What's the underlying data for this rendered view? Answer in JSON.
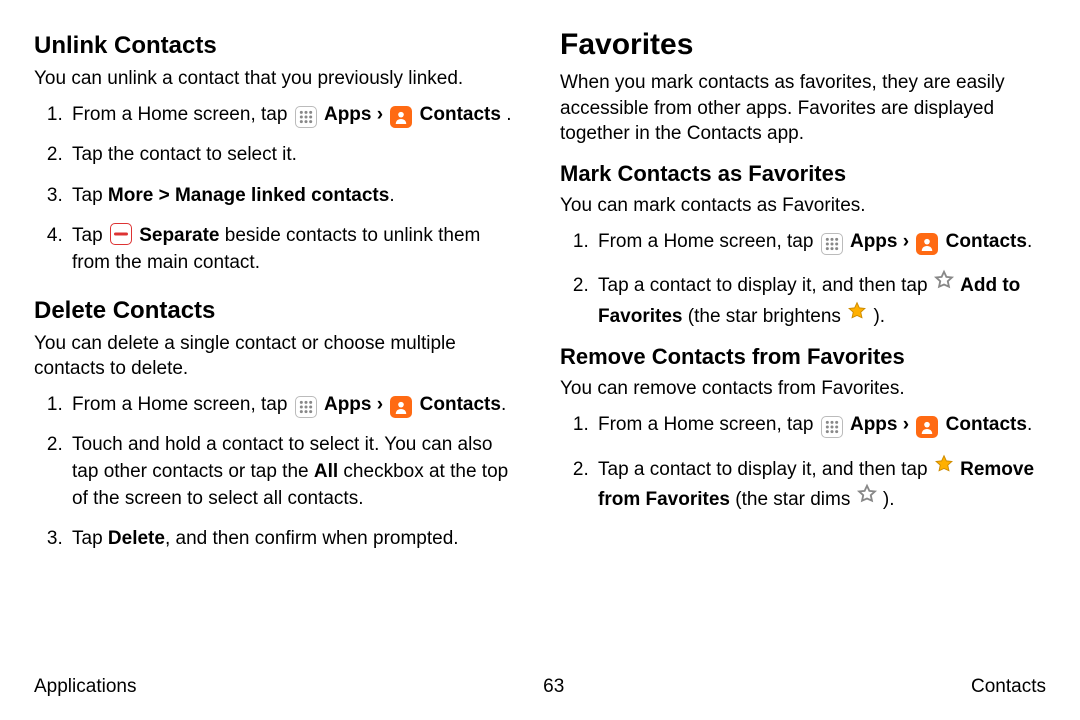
{
  "left": {
    "unlink": {
      "heading": "Unlink Contacts",
      "intro": "You can unlink a contact that you previously linked.",
      "step1a": "From a Home screen, tap ",
      "apps": "Apps",
      "chev": " › ",
      "contacts": "Contacts",
      "period_space": " .",
      "step2": "Tap the contact to select it.",
      "step3a": "Tap ",
      "step3b": "More > Manage linked contacts",
      "step3c": ".",
      "step4a": "Tap ",
      "step4b": "Separate",
      "step4c": "  beside contacts to unlink them from the main contact."
    },
    "del": {
      "heading": "Delete Contacts",
      "intro": "You can delete a single contact or choose multiple contacts to delete.",
      "step1a": "From a Home screen, tap ",
      "apps": "Apps",
      "chev": " › ",
      "contacts": "Contacts",
      "period": ".",
      "step2a": "Touch and hold a contact to select it. You can also tap other contacts or tap the ",
      "step2b": "All",
      "step2c": " checkbox at the top of the screen to select all contacts.",
      "step3a": "Tap ",
      "step3b": "Delete",
      "step3c": ", and then confirm when prompted."
    }
  },
  "right": {
    "fav": {
      "heading": "Favorites",
      "intro": "When you mark contacts as favorites, they are easily accessible from other apps. Favorites are displayed together in the Contacts app."
    },
    "mark": {
      "heading": "Mark Contacts as Favorites",
      "intro": "You can mark contacts as Favorites.",
      "step1a": "From a Home screen, tap ",
      "apps": "Apps",
      "chev": " › ",
      "contacts": "Contacts",
      "period": ".",
      "step2a": "Tap a contact to display it, and then tap ",
      "step2b": "Add to Favorites",
      "step2c": " (the star brightens ",
      "step2d": ")."
    },
    "remove": {
      "heading": "Remove Contacts from Favorites",
      "intro": "You can remove contacts from Favorites.",
      "step1a": "From a Home screen, tap ",
      "apps": "Apps",
      "chev": "  › ",
      "contacts": "Contacts",
      "period": ".",
      "step2a": "Tap a contact to display it, and then tap ",
      "step2b": "Remove from Favorites",
      "step2c": " (the star dims ",
      "step2d": ")."
    }
  },
  "footer": {
    "left": "Applications",
    "center": "63",
    "right": "Contacts"
  }
}
